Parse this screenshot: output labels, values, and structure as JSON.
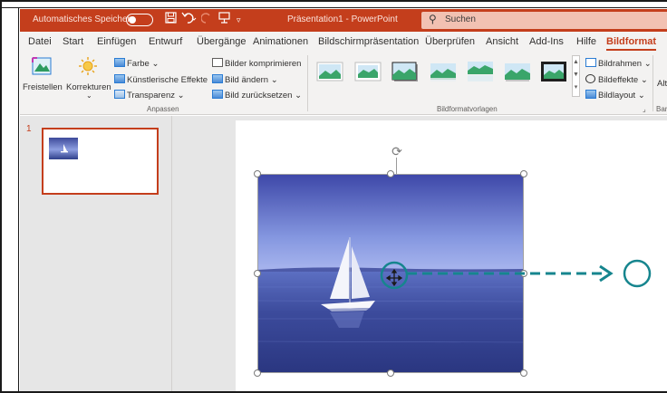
{
  "titlebar": {
    "autosave_label": "Automatisches Speichern",
    "autosave_state": "off",
    "doc_title": "Präsentation1 - PowerPoint",
    "search_placeholder": "Suchen",
    "accent_color": "#c43e1c"
  },
  "quick_access": [
    {
      "icon": "save-icon"
    },
    {
      "icon": "undo-icon"
    },
    {
      "icon": "redo-icon"
    },
    {
      "icon": "presenter-icon"
    },
    {
      "icon": "customize-quick-access-icon"
    }
  ],
  "menu": {
    "tabs": [
      "Datei",
      "Start",
      "Einfügen",
      "Entwurf",
      "Übergänge",
      "Animationen",
      "Bildschirmpräsentation",
      "Überprüfen",
      "Ansicht",
      "Add-Ins",
      "Hilfe",
      "Bildformat"
    ],
    "active": "Bildformat"
  },
  "ribbon": {
    "remove_bg": "Freistellen",
    "corrections": "Korrekturen",
    "color": "Farbe",
    "artistic_effects": "Künstlerische Effekte",
    "transparency": "Transparenz",
    "compress": "Bilder komprimieren",
    "change_picture": "Bild ändern",
    "reset_picture": "Bild zurücksetzen",
    "group_adjust": "Anpassen",
    "group_styles": "Bildformatvorlagen",
    "picture_border": "Bildrahmen",
    "picture_effects": "Bildeffekte",
    "picture_layout": "Bildlayout",
    "alt_cut": "Alt",
    "group_accessibility_cut": "Bar"
  },
  "slides_pane": {
    "slide_number": "1"
  },
  "annotation": {
    "arrow_color": "#16858e"
  }
}
